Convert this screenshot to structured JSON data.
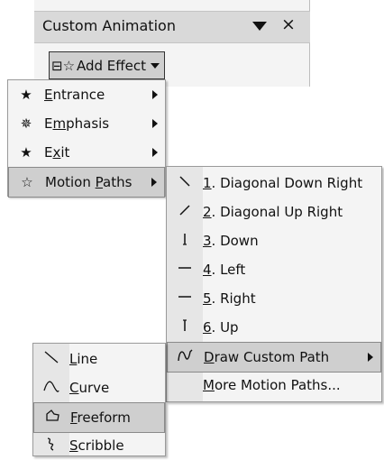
{
  "task_pane": {
    "title": "Custom Animation",
    "close_glyph": "×",
    "add_effect": {
      "label": "Add Effect",
      "icon": "add-effect-icon"
    }
  },
  "effect_menu": {
    "items": [
      {
        "label_pre": "",
        "accel": "E",
        "label_post": "ntrance",
        "icon": "entrance-star-icon",
        "submenu": true
      },
      {
        "label_pre": "E",
        "accel": "m",
        "label_post": "phasis",
        "icon": "emphasis-star-icon",
        "submenu": true
      },
      {
        "label_pre": "E",
        "accel": "x",
        "label_post": "it",
        "icon": "exit-star-icon",
        "submenu": true
      },
      {
        "label_pre": "Motion ",
        "accel": "P",
        "label_post": "aths",
        "icon": "motion-paths-star-icon",
        "submenu": true,
        "highlighted": true
      }
    ]
  },
  "motion_paths_menu": {
    "items": [
      {
        "accel": "1",
        "label": ". Diagonal Down Right",
        "icon": "diagonal-down-right-icon"
      },
      {
        "accel": "2",
        "label": ". Diagonal Up Right",
        "icon": "diagonal-up-right-icon"
      },
      {
        "accel": "3",
        "label": ". Down",
        "icon": "down-path-icon"
      },
      {
        "accel": "4",
        "label": ". Left",
        "icon": "left-path-icon"
      },
      {
        "accel": "5",
        "label": ". Right",
        "icon": "right-path-icon"
      },
      {
        "accel": "6",
        "label": ". Up",
        "icon": "up-path-icon"
      },
      {
        "accel": "D",
        "label": "raw Custom Path",
        "icon": "draw-custom-path-icon",
        "submenu": true,
        "highlighted": true
      },
      {
        "accel": "M",
        "label": "ore Motion Paths...",
        "icon": ""
      }
    ]
  },
  "custom_path_menu": {
    "items": [
      {
        "accel": "L",
        "label": "ine",
        "icon": "line-icon"
      },
      {
        "accel": "C",
        "label": "urve",
        "icon": "curve-icon"
      },
      {
        "accel": "F",
        "label": "reeform",
        "icon": "freeform-icon",
        "highlighted": true
      },
      {
        "accel": "S",
        "label": "cribble",
        "icon": "scribble-icon"
      }
    ]
  }
}
